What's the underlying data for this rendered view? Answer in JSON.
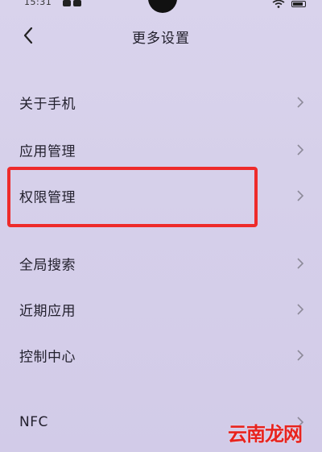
{
  "status_bar": {
    "time": "15:31"
  },
  "header": {
    "title": "更多设置"
  },
  "menu": {
    "items": [
      {
        "label": "关于手机"
      },
      {
        "label": "应用管理"
      },
      {
        "label": "权限管理",
        "highlighted": true
      },
      {
        "label": "全局搜索"
      },
      {
        "label": "近期应用"
      },
      {
        "label": "控制中心"
      },
      {
        "label": "NFC"
      }
    ]
  },
  "watermark": {
    "text": "云南龙网"
  },
  "colors": {
    "background": "#d6d0ea",
    "highlight_border": "#ee2b2b",
    "watermark": "#e8231e"
  }
}
